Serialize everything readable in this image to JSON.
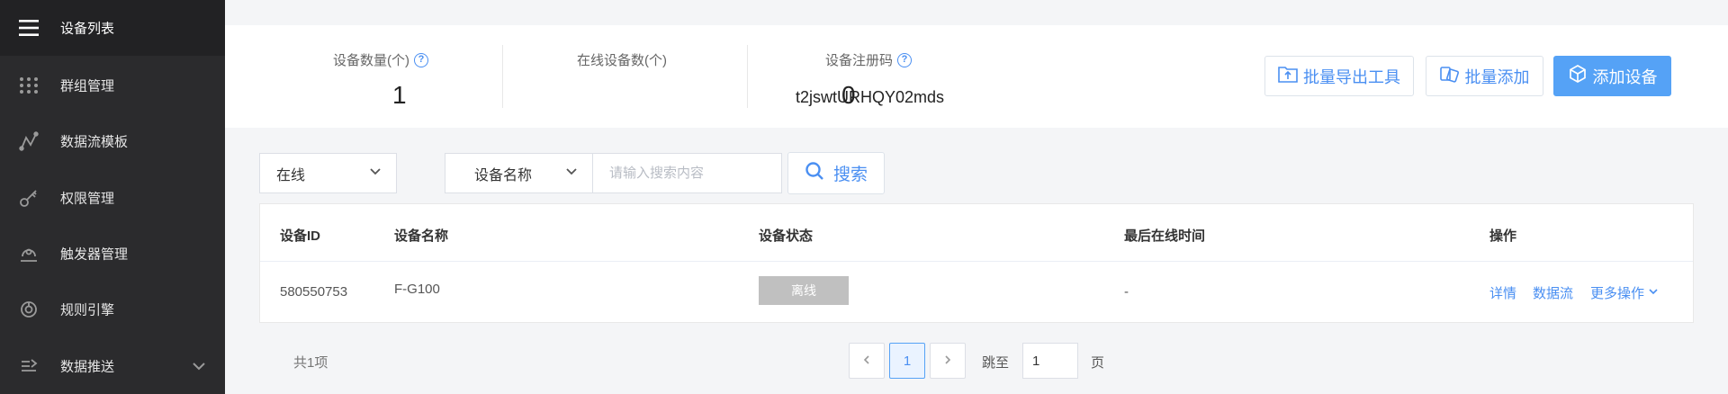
{
  "sidebar": {
    "items": [
      {
        "label": "设备列表",
        "icon": "menu-icon"
      },
      {
        "label": "群组管理",
        "icon": "grid-dots-icon"
      },
      {
        "label": "数据流模板",
        "icon": "data-flow-icon"
      },
      {
        "label": "权限管理",
        "icon": "key-icon"
      },
      {
        "label": "触发器管理",
        "icon": "trigger-icon"
      },
      {
        "label": "规则引擎",
        "icon": "rule-engine-icon"
      },
      {
        "label": "数据推送",
        "icon": "data-push-icon"
      }
    ]
  },
  "stats": {
    "device_count": {
      "label": "设备数量(个)",
      "value": "1"
    },
    "online_count": {
      "label": "在线设备数(个)",
      "value": "0"
    },
    "register_code": {
      "label": "设备注册码",
      "value": "t2jswtURHQY02mds"
    }
  },
  "actions": {
    "batch_export": "批量导出工具",
    "batch_add": "批量添加",
    "add_device": "添加设备"
  },
  "filters": {
    "status_value": "在线",
    "field_value": "设备名称",
    "search_placeholder": "请输入搜索内容",
    "search_label": "搜索"
  },
  "table": {
    "headers": [
      "设备ID",
      "设备名称",
      "设备状态",
      "最后在线时间",
      "操作"
    ],
    "rows": [
      {
        "id": "580550753",
        "name": "F-G100",
        "status": "离线",
        "last_online": "-",
        "ops": {
          "detail": "详情",
          "stream": "数据流",
          "more": "更多操作"
        }
      }
    ]
  },
  "pagination": {
    "total": "共1项",
    "current": "1",
    "goto_label": "跳至",
    "goto_value": "1",
    "page_unit": "页"
  },
  "colors": {
    "sidebar_bg": "#2b2b2d",
    "accent": "#4a8ff2",
    "primary_button": "#55a2f6",
    "offline_badge": "#c0c0c0"
  }
}
